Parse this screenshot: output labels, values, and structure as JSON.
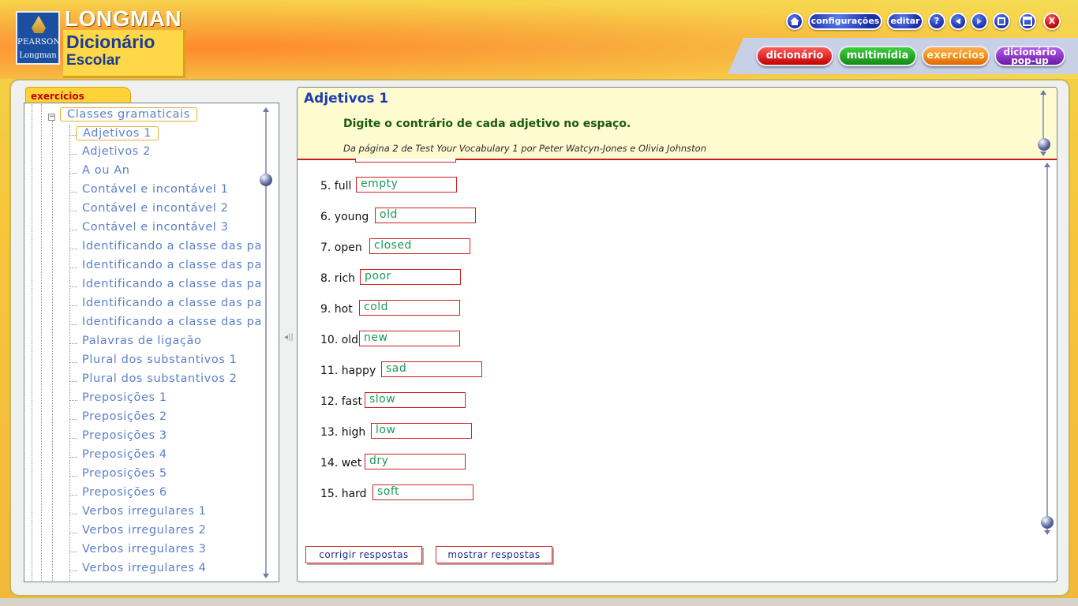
{
  "brand": {
    "publisher_line1": "PEARSON",
    "publisher_line2": "Longman",
    "name": "LONGMAN",
    "title_line1": "Dicionário",
    "title_line2": "Escolar"
  },
  "toolbar": {
    "home_icon": "home-icon",
    "settings_label": "configurações",
    "edit_label": "editar",
    "help_label": "?",
    "close_label": "X"
  },
  "nav": {
    "dictionary": "dicionário",
    "multimedia": "multimídia",
    "exercises": "exercícios",
    "popup_line1": "dicionário",
    "popup_line2": "pop-up"
  },
  "sidebar": {
    "tab_label": "exercícios",
    "root": "Classes gramaticais",
    "items": [
      "Adjetivos 1",
      "Adjetivos 2",
      "A ou An",
      "Contável e incontável 1",
      "Contável e incontável 2",
      "Contável e incontável 3",
      "Identificando a classe das pa",
      "Identificando a classe das pa",
      "Identificando a classe das pa",
      "Identificando a classe das pa",
      "Identificando a classe das pa",
      "Palavras de ligação",
      "Plural dos substantivos 1",
      "Plural dos substantivos 2",
      "Preposições 1",
      "Preposições 2",
      "Preposições 3",
      "Preposições 4",
      "Preposições 5",
      "Preposições 6",
      "Verbos irregulares 1",
      "Verbos irregulares 2",
      "Verbos irregulares 3",
      "Verbos irregulares 4"
    ]
  },
  "exercise": {
    "title": "Adjetivos 1",
    "instruction": "Digite o contrário de cada adjetivo no espaço.",
    "source": "Da página 2 de Test Your Vocabulary 1 por Peter Watcyn-Jones e Olivia Johnston",
    "questions": [
      {
        "label": "5. full",
        "answer": "empty"
      },
      {
        "label": "6. young",
        "answer": "old"
      },
      {
        "label": "7. open",
        "answer": "closed"
      },
      {
        "label": "8. rich",
        "answer": "poor"
      },
      {
        "label": "9. hot",
        "answer": "cold"
      },
      {
        "label": "10. old",
        "answer": "new"
      },
      {
        "label": "11. happy",
        "answer": "sad"
      },
      {
        "label": "12. fast",
        "answer": "slow"
      },
      {
        "label": "13. high",
        "answer": "low"
      },
      {
        "label": "14. wet",
        "answer": "dry"
      },
      {
        "label": "15. hard",
        "answer": "soft"
      }
    ],
    "check_label": "corrigir respostas",
    "show_label": "mostrar respostas"
  }
}
